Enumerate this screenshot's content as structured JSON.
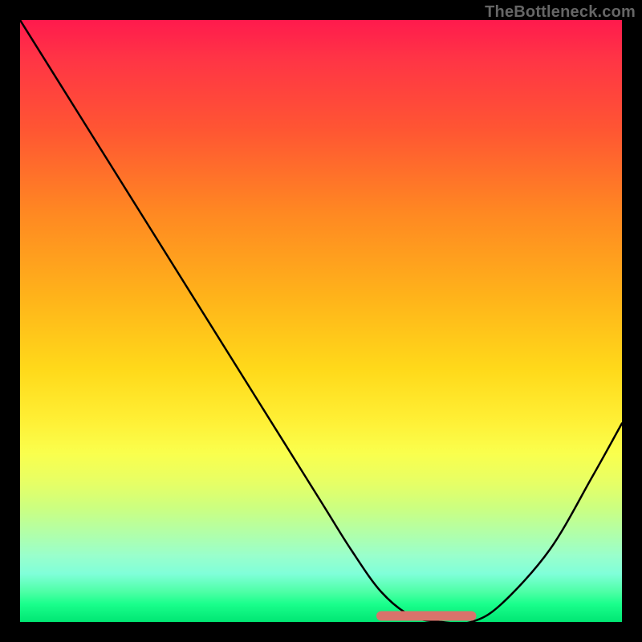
{
  "watermark": "TheBottleneck.com",
  "chart_data": {
    "type": "line",
    "title": "",
    "xlabel": "",
    "ylabel": "",
    "xlim": [
      0,
      100
    ],
    "ylim": [
      0,
      100
    ],
    "series": [
      {
        "name": "bottleneck-curve",
        "x": [
          0,
          10,
          20,
          30,
          40,
          50,
          55,
          60,
          65,
          70,
          75,
          80,
          88,
          95,
          100
        ],
        "values": [
          100,
          84,
          68,
          52,
          36,
          20,
          12,
          5,
          1,
          0,
          0,
          3,
          12,
          24,
          33
        ]
      },
      {
        "name": "optimal-span",
        "x": [
          60,
          75
        ],
        "values": [
          1,
          1
        ]
      }
    ],
    "colors": {
      "curve": "#000000",
      "optimal": "#d9736b",
      "gradient_top": "#ff1a4d",
      "gradient_bottom": "#00e673"
    }
  }
}
